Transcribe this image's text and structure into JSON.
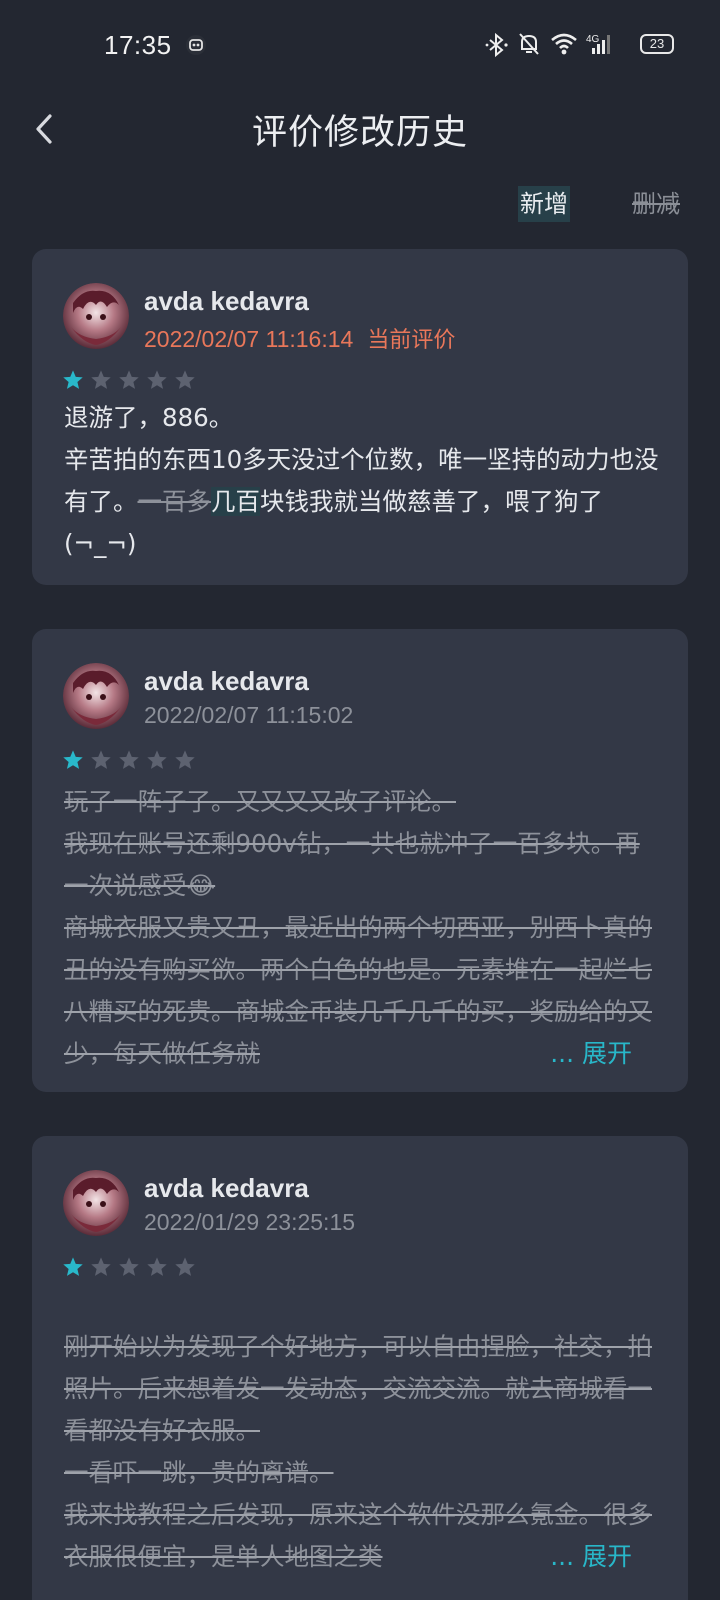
{
  "status_bar": {
    "time": "17:35",
    "battery": "23",
    "icons": [
      "bluetooth-icon",
      "mute-bell-icon",
      "wifi-icon",
      "signal-4g-icon",
      "battery-icon"
    ]
  },
  "header": {
    "title": "评价修改历史",
    "back_icon": "chevron-left-icon"
  },
  "legend": {
    "added": "新增",
    "deleted": "删减"
  },
  "colors": {
    "background": "#232731",
    "card": "#333846",
    "accent": "#28b7c9",
    "current_label": "#e9775a",
    "added_highlight": "#274049"
  },
  "reviews": [
    {
      "user": "avda kedavra",
      "timestamp": "2022/02/07 11:16:14",
      "current_label": "当前评价",
      "rating": 1,
      "rating_max": 5,
      "lines": {
        "l1": "退游了，886。",
        "l2a": "辛苦拍的东西10多天没过个位数，唯一坚持的动力也没有了。",
        "deleted": "一百多",
        "added": "几百",
        "l2b": "块钱我就当做慈善了，喂了狗了(¬_¬)"
      }
    },
    {
      "user": "avda kedavra",
      "timestamp": "2022/02/07 11:15:02",
      "rating": 1,
      "rating_max": 5,
      "lines": {
        "l1": "玩了一阵子了。又又又又改了评论。",
        "l2": "我现在账号还剩900v钻，一共也就冲了一百多块。再一次说感受😂",
        "l3": "商城衣服又贵又丑，最近出的两个切西亚，别西卜真的丑的没有购买欲。两个白色的也是。元素堆在一起烂七八糟买的死贵。商城金币装几千几千的买，奖励给的又少，每天做任务就"
      },
      "expand": "... 展开"
    },
    {
      "user": "avda kedavra",
      "timestamp": "2022/01/29 23:25:15",
      "rating": 1,
      "rating_max": 5,
      "lines": {
        "l1": "刚开始以为发现了个好地方，可以自由捏脸，社交，拍照片。后来想着发一发动态，交流交流。就去商城看一看都没有好衣服。",
        "l2": "一看吓一跳，贵的离谱。",
        "l3": "我来找教程之后发现，原来这个软件没那么氪金。很多衣服很便宜，是单人地图之类"
      },
      "expand": "... 展开"
    }
  ]
}
